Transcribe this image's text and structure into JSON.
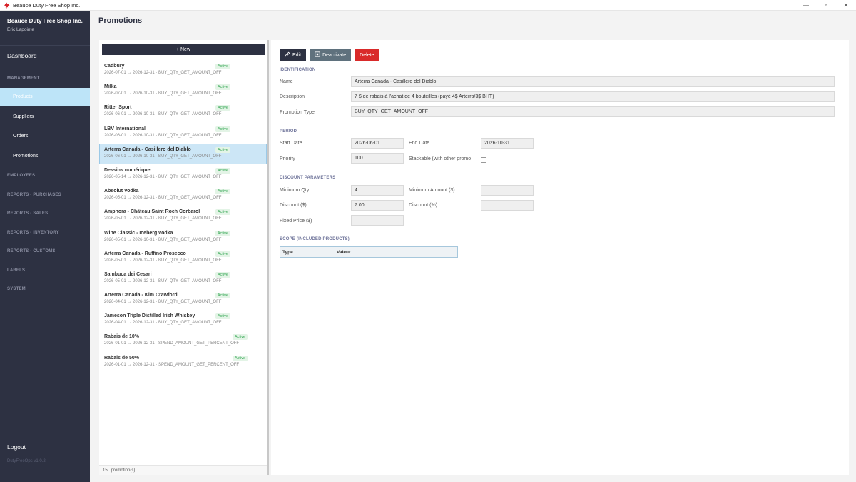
{
  "window": {
    "title": "Beauce Duty Free Shop Inc.",
    "controls": [
      "—",
      "▫",
      "✕"
    ]
  },
  "sidebar": {
    "brand": "Beauce Duty Free Shop Inc.",
    "user": "Éric Lapointe",
    "dashboard": "Dashboard",
    "sections": {
      "management": "MANAGEMENT",
      "employees": "EMPLOYEES",
      "reports_purchases": "REPORTS - PURCHASES",
      "reports_sales": "REPORTS - SALES",
      "reports_inventory": "REPORTS - INVENTORY",
      "reports_customs": "REPORTS - CUSTOMS",
      "labels": "LABELS",
      "system": "SYSTEM"
    },
    "management_items": [
      "Products",
      "Suppliers",
      "Orders",
      "Promotions"
    ],
    "logout": "Logout",
    "version": "DutyFreeOps v1.0.2"
  },
  "header": {
    "title": "Promotions"
  },
  "list": {
    "new_button": "+ New",
    "items": [
      {
        "name": "Cadbury",
        "meta": "2026-07-01 → 2026-12-31  ·  BUY_QTY_GET_AMOUNT_OFF",
        "status": "Active"
      },
      {
        "name": "Milka",
        "meta": "2026-07-01 → 2026-10-31  ·  BUY_QTY_GET_AMOUNT_OFF",
        "status": "Active"
      },
      {
        "name": "Ritter Sport",
        "meta": "2026-06-01 → 2026-10-31  ·  BUY_QTY_GET_AMOUNT_OFF",
        "status": "Active"
      },
      {
        "name": "LBV International",
        "meta": "2026-06-01 → 2026-10-31  ·  BUY_QTY_GET_AMOUNT_OFF",
        "status": "Active"
      },
      {
        "name": "Arterra Canada - Casillero del Diablo",
        "meta": "2026-06-01 → 2026-10-31  ·  BUY_QTY_GET_AMOUNT_OFF",
        "status": "Active"
      },
      {
        "name": "Dessins numérique",
        "meta": "2026-05-14 → 2026-12-31  ·  BUY_QTY_GET_AMOUNT_OFF",
        "status": "Active"
      },
      {
        "name": "Absolut Vodka",
        "meta": "2026-05-01 → 2026-12-31  ·  BUY_QTY_GET_AMOUNT_OFF",
        "status": "Active"
      },
      {
        "name": "Amphora - Château Saint Roch Corbarol",
        "meta": "2026-05-01 → 2026-12-31  ·  BUY_QTY_GET_AMOUNT_OFF",
        "status": "Active"
      },
      {
        "name": "Wine Classic - Iceberg vodka",
        "meta": "2026-05-01 → 2026-10-31  ·  BUY_QTY_GET_AMOUNT_OFF",
        "status": "Active"
      },
      {
        "name": "Arterra Canada - Ruffino Prosecco",
        "meta": "2026-05-01 → 2026-12-31  ·  BUY_QTY_GET_AMOUNT_OFF",
        "status": "Active"
      },
      {
        "name": "Sambuca dei Cesari",
        "meta": "2026-05-01 → 2026-12-31  ·  BUY_QTY_GET_AMOUNT_OFF",
        "status": "Active"
      },
      {
        "name": "Arterra Canada - Kim Crawford",
        "meta": "2026-04-01 → 2026-12-31  ·  BUY_QTY_GET_AMOUNT_OFF",
        "status": "Active"
      },
      {
        "name": "Jameson Triple Distilled Irish Whiskey",
        "meta": "2026-04-01 → 2026-12-31  ·  BUY_QTY_GET_AMOUNT_OFF",
        "status": "Active"
      },
      {
        "name": "Rabais de 10%",
        "meta": "2026-01-01 → 2026-12-31  ·  SPEND_AMOUNT_GET_PERCENT_OFF",
        "status": "Active"
      },
      {
        "name": "Rabais de 50%",
        "meta": "2026-01-01 → 2026-12-31  ·  SPEND_AMOUNT_GET_PERCENT_OFF",
        "status": "Active"
      }
    ],
    "footer_count": "15",
    "footer_label": "promotion(s)"
  },
  "detail": {
    "buttons": {
      "edit": "Edit",
      "deactivate": "Deactivate",
      "delete": "Delete"
    },
    "identification": {
      "title": "IDENTIFICATION",
      "name_label": "Name",
      "name_value": "Arterra Canada - Casillero del Diablo",
      "description_label": "Description",
      "description_value": "7 $ de rabais à l'achat de 4 bouteilles (payé 4$ Arterra/3$ BHT)",
      "type_label": "Promotion Type",
      "type_value": "BUY_QTY_GET_AMOUNT_OFF"
    },
    "period": {
      "title": "PERIOD",
      "start_label": "Start Date",
      "start_value": "2026-06-01",
      "end_label": "End Date",
      "end_value": "2026-10-31",
      "priority_label": "Priority",
      "priority_value": "100",
      "stackable_label": "Stackable (with other promo"
    },
    "discount": {
      "title": "DISCOUNT PARAMETERS",
      "min_qty_label": "Minimum Qty",
      "min_qty_value": "4",
      "min_amount_label": "Minimum Amount ($)",
      "min_amount_value": "",
      "discount_amt_label": "Discount ($)",
      "discount_amt_value": "7.00",
      "discount_pct_label": "Discount (%)",
      "discount_pct_value": "",
      "fixed_price_label": "Fixed Price ($)",
      "fixed_price_value": ""
    },
    "scope": {
      "title": "SCOPE (INCLUDED PRODUCTS)",
      "col_type": "Type",
      "col_value": "Valeur"
    }
  }
}
